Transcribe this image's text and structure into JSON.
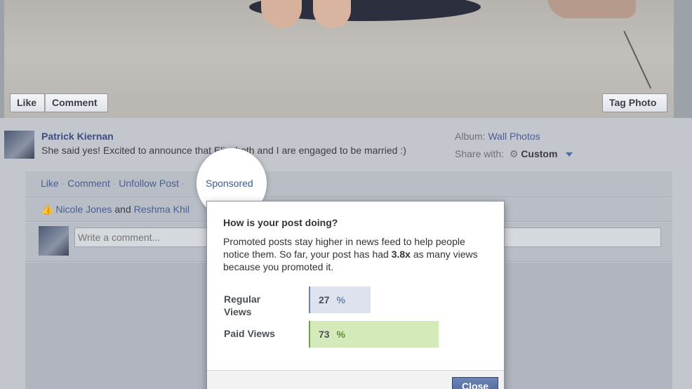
{
  "photo": {
    "like_label": "Like",
    "comment_label": "Comment",
    "tag_label": "Tag Photo"
  },
  "post": {
    "author": "Patrick Kiernan",
    "text": "She said yes! Excited to announce that Elizabeth and I are engaged to be married :)",
    "album_label": "Album:",
    "album_value": "Wall Photos",
    "share_label": "Share with:",
    "share_value": "Custom"
  },
  "actions": {
    "like": "Like",
    "comment": "Comment",
    "unfollow": "Unfollow Post",
    "sponsored": "Sponsored",
    "separator": "·"
  },
  "likes": {
    "person1": "Nicole Jones",
    "and": "and",
    "person2": "Reshma Khil"
  },
  "comment_box": {
    "placeholder": "Write a comment..."
  },
  "popup": {
    "title": "How is your post doing?",
    "desc_prefix": "Promoted posts stay higher in news feed to help people notice them. So far, your post has had",
    "multiplier": "3.8x",
    "desc_suffix": "as many views because you promoted it.",
    "stats": [
      {
        "label": "Regular Views",
        "value": 27,
        "unit": "%"
      },
      {
        "label": "Paid Views",
        "value": 73,
        "unit": "%"
      }
    ],
    "close_label": "Close"
  }
}
